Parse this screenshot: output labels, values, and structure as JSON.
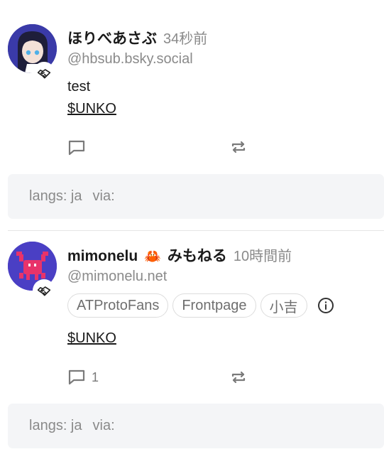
{
  "posts": [
    {
      "display_name": "ほりべあさぶ",
      "timestamp": "34秒前",
      "handle": "@hbsub.bsky.social",
      "text_line": "test",
      "cashtag": "$UNKO",
      "reply_count": "",
      "meta": {
        "langs": "langs: ja",
        "via": "via:"
      }
    },
    {
      "display_name": "mimonelu",
      "name_emoji": "🦀",
      "display_name_suffix": "みもねる",
      "timestamp": "10時間前",
      "handle": "@mimonelu.net",
      "labels": [
        "ATProtoFans",
        "Frontpage",
        "小吉"
      ],
      "cashtag": "$UNKO",
      "reply_count": "1",
      "meta": {
        "langs": "langs: ja",
        "via": "via:"
      }
    }
  ],
  "icons": {
    "badge": "handshake-icon",
    "reply": "speech-bubble-icon",
    "repost": "repost-arrows-icon",
    "info": "info-circle-icon"
  },
  "colors": {
    "avatar1_bg": "#3a3aa8",
    "avatar2_bg": "#4a3fc4",
    "crab": "#e8336a",
    "meta_bg": "#f4f5f7",
    "muted_text": "#8a8a8a"
  }
}
